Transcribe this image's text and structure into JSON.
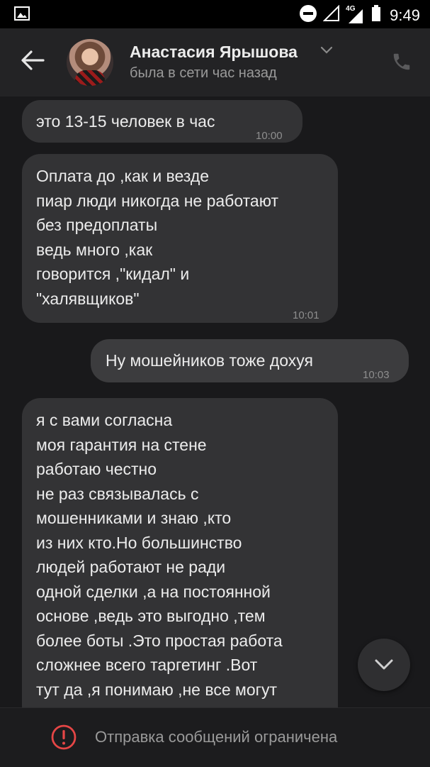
{
  "status_bar": {
    "network": "4G",
    "time": "9:49"
  },
  "header": {
    "contact_name": "Анастасия Ярышова",
    "contact_status": "была в сети час назад"
  },
  "messages": [
    {
      "direction": "in",
      "text": "это 13-15 человек в час",
      "time": "10:00"
    },
    {
      "direction": "in",
      "text": "Оплата до ,как и везде\nпиар люди никогда не работают\nбез предоплаты\nведь много ,как\nговорится ,\"кидал\" и\n\"халявщиков\"",
      "time": "10:01"
    },
    {
      "direction": "out",
      "text": "Ну мошейников тоже дохуя",
      "time": "10:03"
    },
    {
      "direction": "in",
      "text": "я с вами согласна\nмоя гарантия на стене\nработаю честно\nне раз связывалась с\nмошенниками и знаю ,кто\nиз них кто.Но большинство\nлюдей работают не ради\nодной сделки ,а на постоянной\nоснове ,ведь это выгодно ,тем\nболее боты .Это простая работа\nсложнее всего таргетинг .Вот\nтут да ,я понимаю ,не все могут",
      "time": ""
    }
  ],
  "bottom_bar": {
    "notice": "Отправка сообщений ограничена"
  },
  "icons": {
    "back": "arrow-left-icon",
    "call": "phone-icon",
    "scroll": "chevron-down-icon",
    "alert": "exclamation-circle-icon"
  },
  "colors": {
    "background": "#19191b",
    "header": "#232325",
    "bubble_in": "#333335",
    "bubble_out": "#3c3c3e",
    "alert": "#e64646"
  }
}
